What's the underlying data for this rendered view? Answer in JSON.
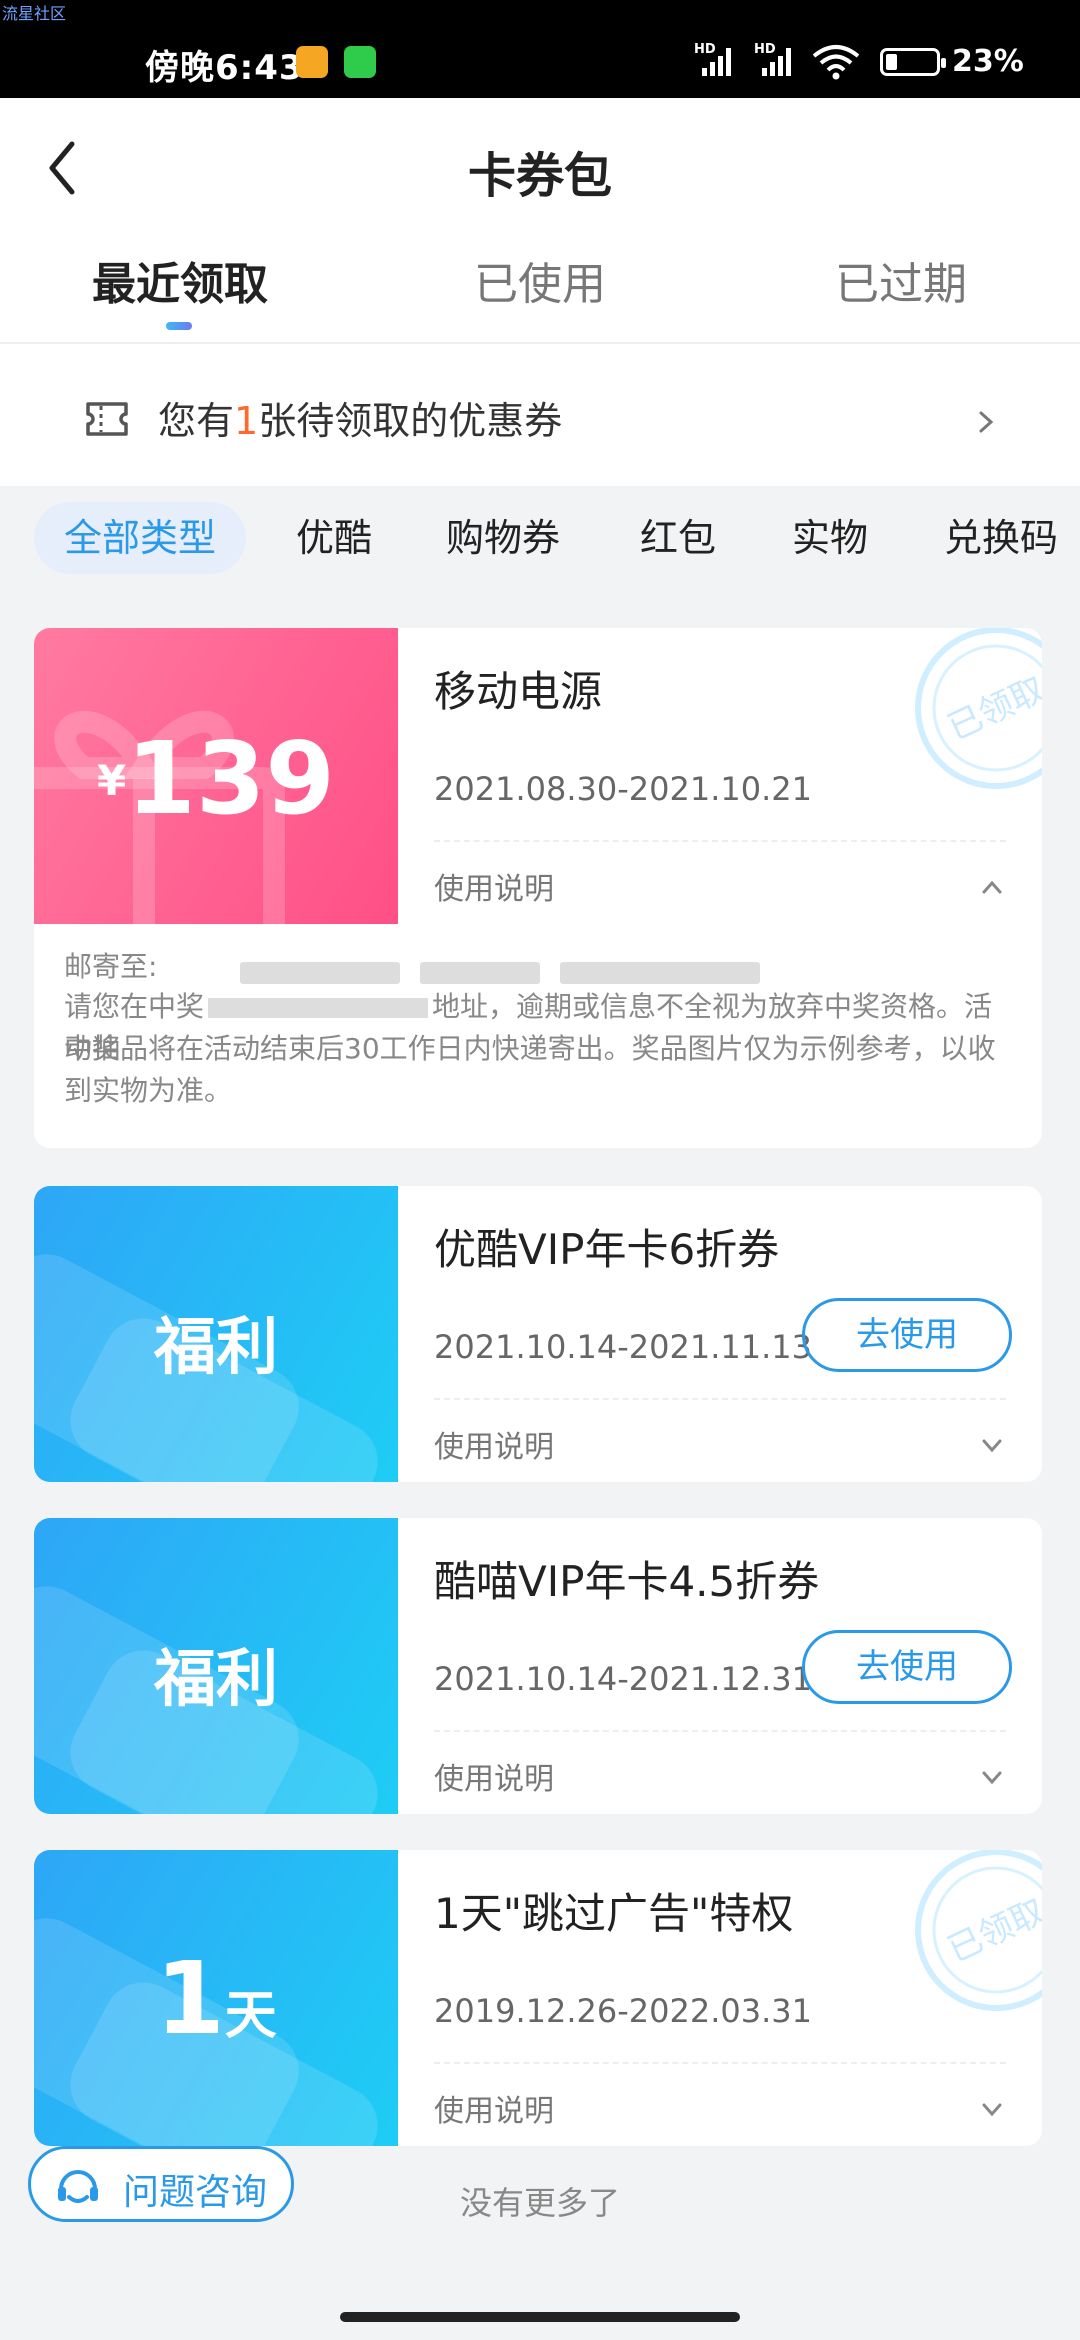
{
  "watermark": "流星社区",
  "status_bar": {
    "time": "傍晚6:43",
    "network1": "HD",
    "network2": "HD",
    "battery": "23%"
  },
  "header": {
    "title": "卡券包",
    "tabs": [
      {
        "label": "最近领取"
      },
      {
        "label": "已使用"
      },
      {
        "label": "已过期"
      }
    ]
  },
  "banner": {
    "prefix": "您有",
    "count": "1",
    "suffix": "张待领取的优惠券"
  },
  "filters": [
    "全部类型",
    "优酷",
    "购物券",
    "红包",
    "实物",
    "兑换码"
  ],
  "cards": [
    {
      "left_currency": "¥",
      "left_value": "139",
      "title": "移动电源",
      "date": "2021.08.30-2021.10.21",
      "help": "使用说明",
      "stamp": "已领取",
      "detail": {
        "label": "邮寄至:",
        "text1": "请您在中奖",
        "text2": "地址，逾期或信息不全视为放弃中奖资格。活动抽",
        "text3": "中奖品将在活动结束后30工作日内快递寄出。奖品图片仅为示例参考，以收",
        "text4": "到实物为准。"
      }
    },
    {
      "left_label": "福利",
      "title": "优酷VIP年卡6折券",
      "date": "2021.10.14-2021.11.13",
      "help": "使用说明",
      "button": "去使用"
    },
    {
      "left_label": "福利",
      "title": "酷喵VIP年卡4.5折券",
      "date": "2021.10.14-2021.12.31",
      "help": "使用说明",
      "button": "去使用"
    },
    {
      "left_num": "1",
      "left_unit": "天",
      "title": "1天\"跳过广告\"特权",
      "date": "2019.12.26-2022.03.31",
      "help": "使用说明",
      "stamp": "已领取"
    }
  ],
  "footer": {
    "no_more": "没有更多了",
    "consult": "问题咨询"
  },
  "colors": {
    "accent": "#2a9ae8",
    "pink": "#ff5a8c",
    "blue": "#1ebcf5",
    "highlight": "#ff6a2b"
  }
}
